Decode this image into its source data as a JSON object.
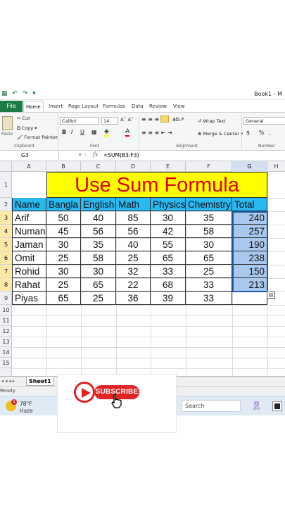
{
  "window": {
    "title": "Book1 - M"
  },
  "ribbon_tabs": [
    "File",
    "Home",
    "Insert",
    "Page Layout",
    "Formulas",
    "Data",
    "Review",
    "View"
  ],
  "ribbon": {
    "paste": "Paste",
    "cut": "Cut",
    "copy": "Copy",
    "format_painter": "Format Painter",
    "clipboard": "Clipboard",
    "font_name": "Calibri",
    "font_size": "14",
    "font_group": "Font",
    "wrap_text": "Wrap Text",
    "merge_center": "Merge & Center",
    "alignment": "Alignment",
    "number_format": "General",
    "number": "Number",
    "bold": "B",
    "italic": "I",
    "underline": "U",
    "percent": "%",
    "currency": "$",
    "comma": ","
  },
  "formula_bar": {
    "name_box": "G3",
    "fx": "fx",
    "formula": "=SUM(B3:F3)"
  },
  "columns": [
    "A",
    "B",
    "C",
    "D",
    "E",
    "F",
    "G",
    "H"
  ],
  "rows": [
    "1",
    "2",
    "3",
    "4",
    "5",
    "6",
    "7",
    "8",
    "9",
    "10",
    "11",
    "12",
    "13",
    "14",
    "15"
  ],
  "sheet": {
    "title": "Use Sum Formula",
    "headers": [
      "Name",
      "Bangla",
      "English",
      "Math",
      "Physics",
      "Chemistry",
      "Total"
    ],
    "data": [
      [
        "Arif",
        "50",
        "40",
        "85",
        "30",
        "35",
        "240"
      ],
      [
        "Numan",
        "45",
        "56",
        "56",
        "42",
        "58",
        "257"
      ],
      [
        "Jaman",
        "30",
        "35",
        "40",
        "55",
        "30",
        "190"
      ],
      [
        "Omit",
        "25",
        "58",
        "25",
        "65",
        "65",
        "238"
      ],
      [
        "Rohid",
        "30",
        "30",
        "32",
        "33",
        "25",
        "150"
      ],
      [
        "Rahat",
        "25",
        "65",
        "22",
        "68",
        "33",
        "213"
      ],
      [
        "Piyas",
        "65",
        "25",
        "36",
        "39",
        "33",
        ""
      ]
    ]
  },
  "sheet_tabs": {
    "active": "Sheet1"
  },
  "status": {
    "text": "Ready"
  },
  "taskbar": {
    "temp": "78°F",
    "condition": "Haze",
    "search": "Search",
    "badge": "1"
  },
  "overlay": {
    "subscribe": "SUBSCRIBE"
  },
  "colors": {
    "header_fill": "#29b8f0",
    "title_fill": "#ffff00",
    "title_text": "#e00000",
    "selection": "#a8c8ed",
    "excel_green": "#1d7a44",
    "subscribe_red": "#e02424"
  }
}
